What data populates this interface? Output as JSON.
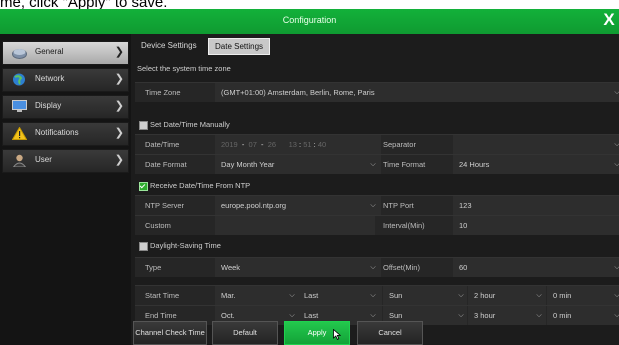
{
  "caption": "me, click \"Apply\" to save.",
  "window": {
    "title": "Configuration",
    "close_glyph": "X"
  },
  "sidebar": {
    "items": [
      {
        "label": "General",
        "icon": "general-icon",
        "active": true
      },
      {
        "label": "Network",
        "icon": "network-icon"
      },
      {
        "label": "Display",
        "icon": "display-icon"
      },
      {
        "label": "Notifications",
        "icon": "warning-icon"
      },
      {
        "label": "User",
        "icon": "user-icon"
      }
    ]
  },
  "tabs": [
    {
      "label": "Device Settings"
    },
    {
      "label": "Date Settings",
      "active": true
    }
  ],
  "section_timezone": "Select the system time zone",
  "timezone": {
    "label": "Time Zone",
    "value": "(GMT+01:00) Amsterdam, Berlin, Rome, Paris"
  },
  "manual": {
    "checkbox_label": "Set Date/Time Manually",
    "checked": false,
    "datetime_label": "Date/Time",
    "date_year": "2019",
    "date_month": "07",
    "date_day": "26",
    "date_sep": "-",
    "time_h": "13",
    "time_m": "51",
    "time_s": "40",
    "time_sep": ":",
    "separator_label": "Separator",
    "separator_value": "",
    "date_format_label": "Date Format",
    "date_format_value": "Day Month Year",
    "time_format_label": "Time Format",
    "time_format_value": "24 Hours"
  },
  "ntp": {
    "checkbox_label": "Receive Date/Time From NTP",
    "checked": true,
    "server_label": "NTP Server",
    "server_value": "europe.pool.ntp.org",
    "port_label": "NTP Port",
    "port_value": "123",
    "custom_label": "Custom",
    "interval_label": "Interval(Min)",
    "interval_value": "10"
  },
  "dst": {
    "checkbox_label": "Daylight-Saving Time",
    "checked": false,
    "type_label": "Type",
    "type_value": "Week",
    "offset_label": "Offset(Min)",
    "offset_value": "60",
    "start_label": "Start Time",
    "start": [
      "Mar.",
      "Last",
      "Sun",
      "2 hour",
      "0 min"
    ],
    "end_label": "End Time",
    "end": [
      "Oct.",
      "Last",
      "Sun",
      "3 hour",
      "0 min"
    ]
  },
  "buttons": {
    "channel_check": "Channel Check Time",
    "default": "Default",
    "apply": "Apply",
    "cancel": "Cancel"
  },
  "colors": {
    "accent": "#13a338",
    "title_bar": "#12a837",
    "panel": "#1c1c1c"
  }
}
